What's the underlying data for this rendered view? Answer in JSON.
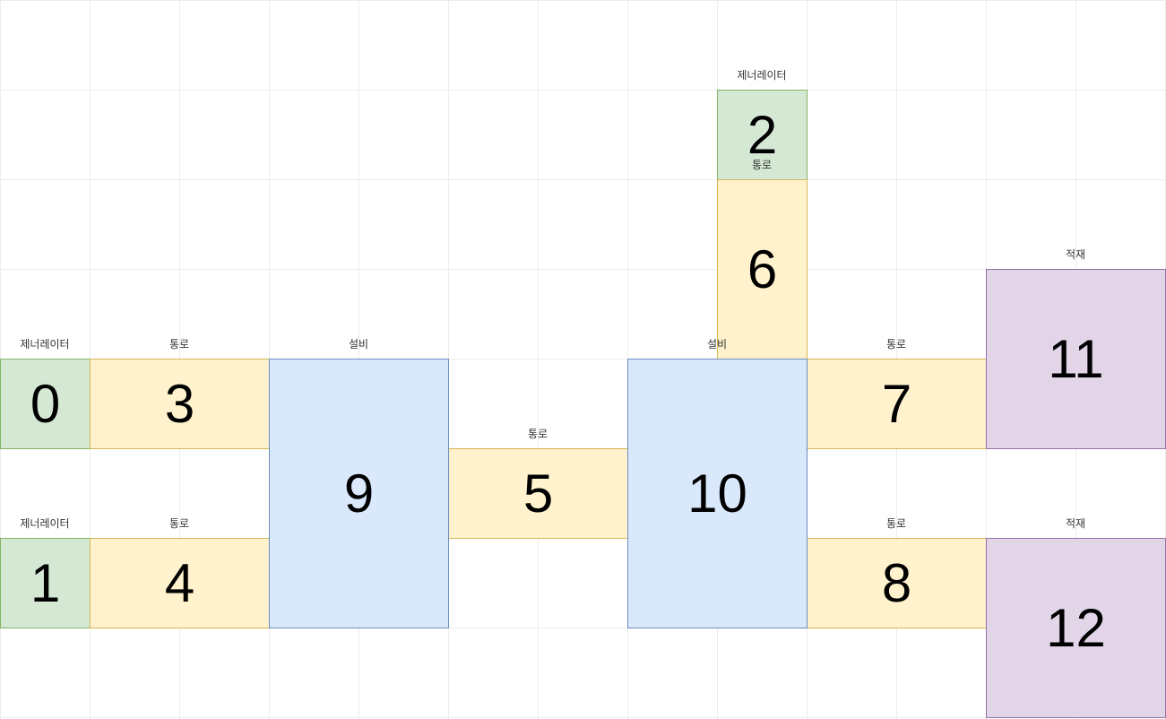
{
  "colors": {
    "generator": "#d5e8d4",
    "passage": "#fff2cc",
    "equipment": "#dae8fc",
    "load": "#e1d5e7"
  },
  "blocks": [
    {
      "id": "0",
      "label": "제너레이터"
    },
    {
      "id": "1",
      "label": "제너레이터"
    },
    {
      "id": "2",
      "label": "제너레이터"
    },
    {
      "id": "3",
      "label": "통로"
    },
    {
      "id": "4",
      "label": "통로"
    },
    {
      "id": "5",
      "label": "통로"
    },
    {
      "id": "6",
      "label": "통로"
    },
    {
      "id": "7",
      "label": "통로"
    },
    {
      "id": "8",
      "label": "통로"
    },
    {
      "id": "9",
      "label": "설비"
    },
    {
      "id": "10",
      "label": "설비"
    },
    {
      "id": "11",
      "label": "적재"
    },
    {
      "id": "12",
      "label": "적재"
    }
  ]
}
